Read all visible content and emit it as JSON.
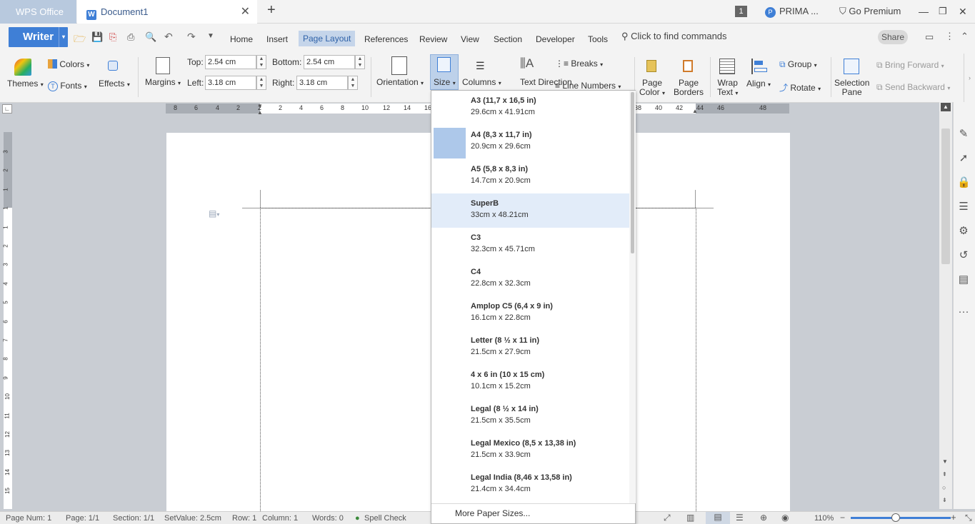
{
  "titlebar": {
    "wps_tab": "WPS Office",
    "doc_tab": "Document1",
    "close": "✕",
    "new_tab": "+",
    "badge": "1",
    "user": "PRIMA ...",
    "premium": "Go Premium"
  },
  "menubar": {
    "writer": "Writer",
    "items": [
      "Home",
      "Insert",
      "Page Layout",
      "References",
      "Review",
      "View",
      "Section",
      "Developer",
      "Tools"
    ],
    "command_search": "Click to find commands",
    "share": "Share"
  },
  "ribbon": {
    "themes": "Themes",
    "colors": "Colors",
    "fonts": "Fonts",
    "effects": "Effects",
    "margins": "Margins",
    "top_label": "Top:",
    "top_value": "2.54 cm",
    "bottom_label": "Bottom:",
    "bottom_value": "2.54 cm",
    "left_label": "Left:",
    "left_value": "3.18 cm",
    "right_label": "Right:",
    "right_value": "3.18 cm",
    "orientation": "Orientation",
    "size": "Size",
    "columns": "Columns",
    "text_direction": "Text Direction",
    "breaks": "Breaks",
    "line_numbers": "Line Numbers",
    "page_color": [
      "Page",
      "Color"
    ],
    "page_borders": [
      "Page",
      "Borders"
    ],
    "wrap_text": [
      "Wrap",
      "Text"
    ],
    "align": "Align",
    "group": "Group",
    "rotate": "Rotate",
    "selection_pane": [
      "Selection",
      "Pane"
    ],
    "bring_forward": "Bring Forward",
    "send_backward": "Send Backward"
  },
  "ruler": {
    "numbers": [
      "8",
      "6",
      "4",
      "2",
      "2",
      "2",
      "4",
      "6",
      "8",
      "10",
      "12",
      "14",
      "16",
      "38",
      "40",
      "42",
      "44",
      "46",
      "48"
    ]
  },
  "vruler": {
    "numbers": [
      "3",
      "2",
      "1",
      "1",
      "1",
      "2",
      "3",
      "4",
      "5",
      "6",
      "7",
      "8",
      "9",
      "10",
      "11",
      "12",
      "13",
      "14",
      "15"
    ]
  },
  "size_dropdown": {
    "items": [
      {
        "name": "A3 (11,7 x 16,5 in)",
        "dims": "29.6cm x 41.91cm"
      },
      {
        "name": "A4 (8,3 x 11,7 in)",
        "dims": "20.9cm x 29.6cm"
      },
      {
        "name": "A5 (5,8 x 8,3 in)",
        "dims": "14.7cm x 20.9cm"
      },
      {
        "name": "SuperB",
        "dims": "33cm x 48.21cm"
      },
      {
        "name": "C3",
        "dims": "32.3cm x 45.71cm"
      },
      {
        "name": "C4",
        "dims": "22.8cm x 32.3cm"
      },
      {
        "name": "Amplop C5 (6,4 x 9 in)",
        "dims": "16.1cm x 22.8cm"
      },
      {
        "name": "Letter (8 ½ x 11 in)",
        "dims": "21.5cm x 27.9cm"
      },
      {
        "name": "4 x 6 in (10 x 15 cm)",
        "dims": "10.1cm x 15.2cm"
      },
      {
        "name": "Legal (8 ½ x 14 in)",
        "dims": "21.5cm x 35.5cm"
      },
      {
        "name": "Legal Mexico (8,5 x 13,38 in)",
        "dims": "21.5cm x 33.9cm"
      },
      {
        "name": "Legal India (8,46 x 13,58 in)",
        "dims": "21.4cm x 34.4cm"
      }
    ],
    "selected_index": 1,
    "hover_index": 3,
    "more": "More Paper Sizes..."
  },
  "status": {
    "page_num": "Page Num: 1",
    "page": "Page: 1/1",
    "section": "Section: 1/1",
    "setvalue": "SetValue: 2.5cm",
    "row": "Row: 1",
    "column": "Column: 1",
    "words": "Words: 0",
    "spell": "Spell Check",
    "zoom": "110%",
    "zoom_level": 0.45
  },
  "colors": {
    "accent": "#3f7fd6",
    "highlight": "#e2ecf9",
    "selected": "#adc8ea"
  }
}
